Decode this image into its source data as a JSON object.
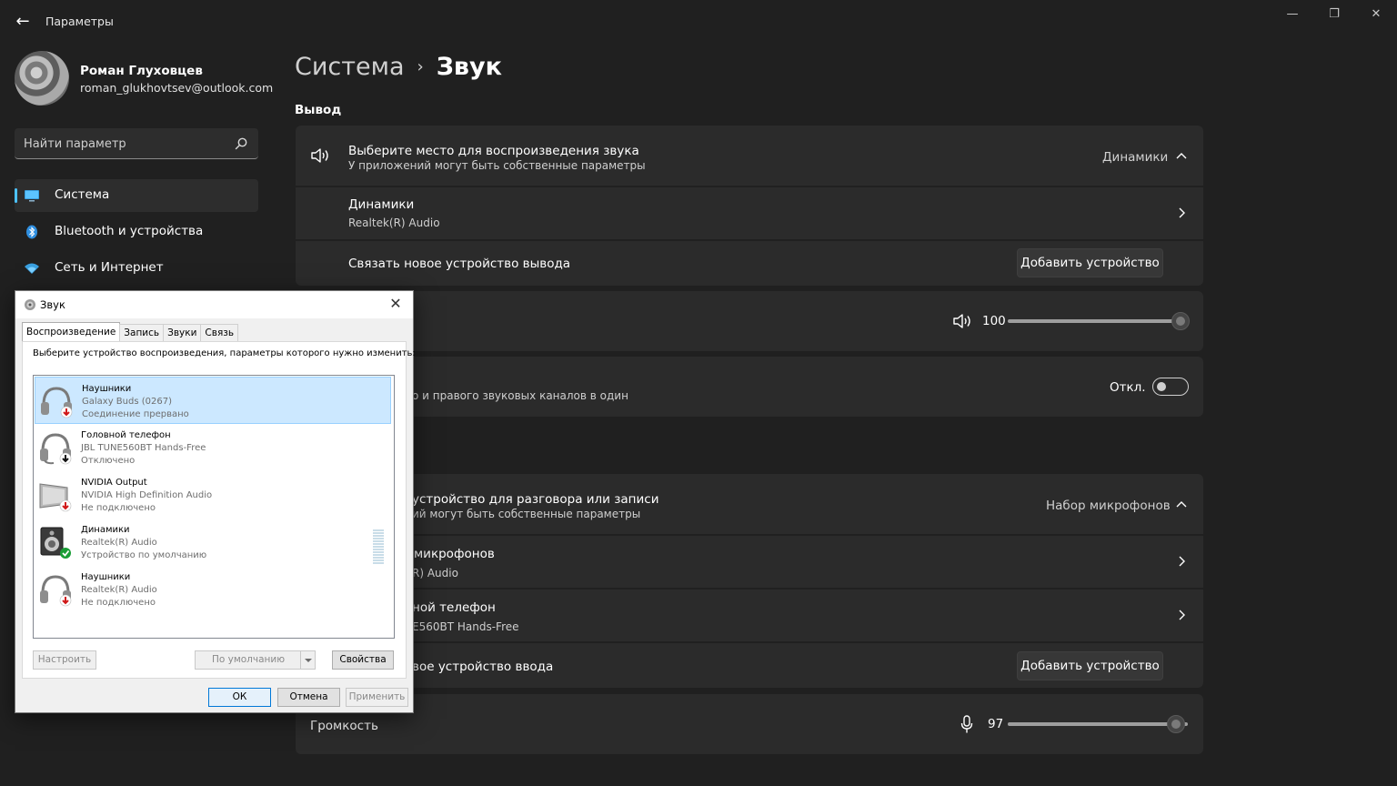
{
  "window": {
    "app_title": "Параметры",
    "back_glyph": "←",
    "minimize_glyph": "—",
    "maximize_glyph": "❐",
    "close_glyph": "✕"
  },
  "profile": {
    "name": "Роман Глуховцев",
    "email": "roman_glukhovtsev@outlook.com"
  },
  "search": {
    "placeholder": "Найти параметр",
    "icon": "search-icon"
  },
  "nav": {
    "items": [
      {
        "label": "Система",
        "icon": "monitor-icon",
        "active": true
      },
      {
        "label": "Bluetooth и устройства",
        "icon": "bluetooth-icon",
        "active": false
      },
      {
        "label": "Сеть и Интернет",
        "icon": "wifi-icon",
        "active": false
      }
    ]
  },
  "breadcrumb": {
    "parent": "Система",
    "separator": "›",
    "current": "Звук"
  },
  "output": {
    "section_title": "Вывод",
    "choose_title": "Выберите место для воспроизведения звука",
    "choose_sub": "У приложений могут быть собственные параметры",
    "choose_value": "Динамики",
    "device_name": "Динамики",
    "device_driver": "Realtek(R) Audio",
    "pair_label": "Связать новое устройство вывода",
    "add_button": "Добавить устройство",
    "volume_value": "100",
    "volume_level": 100,
    "mono_sub_partial": "о и правого звуковых каналов в один",
    "mono_state": "Откл."
  },
  "input": {
    "choose_title_partial": "устройство для разговора или записи",
    "choose_sub_partial": "ий могут быть собственные параметры",
    "choose_value": "Набор микрофонов",
    "device1_name_partial": "микрофонов",
    "device1_driver_partial": "R) Audio",
    "device2_name_partial": "ной телефон",
    "device2_driver_partial": "E560BT Hands-Free",
    "pair_label_partial": "вое устройство ввода",
    "add_button": "Добавить устройство",
    "volume_label": "Громкость",
    "volume_value": "97",
    "volume_level": 97
  },
  "dialog": {
    "title": "Звук",
    "close_glyph": "✕",
    "tabs": [
      "Воспроизведение",
      "Запись",
      "Звуки",
      "Связь"
    ],
    "instruction": "Выберите устройство воспроизведения, параметры которого нужно изменить:",
    "devices": [
      {
        "name": "Наушники",
        "driver": "Galaxy Buds (0267)",
        "status": "Соединение прервано",
        "icon": "headphones-icon",
        "badge": "red-down-arrow",
        "selected": true
      },
      {
        "name": "Головной телефон",
        "driver": "JBL TUNE560BT Hands-Free",
        "status": "Отключено",
        "icon": "headset-icon",
        "badge": "black-down-arrow",
        "selected": false
      },
      {
        "name": "NVIDIA Output",
        "driver": "NVIDIA High Definition Audio",
        "status": "Не подключено",
        "icon": "monitor-speaker-icon",
        "badge": "red-down-arrow",
        "selected": false
      },
      {
        "name": "Динамики",
        "driver": "Realtek(R) Audio",
        "status": "Устройство по умолчанию",
        "icon": "speaker-icon",
        "badge": "green-check",
        "selected": false
      },
      {
        "name": "Наушники",
        "driver": "Realtek(R) Audio",
        "status": "Не подключено",
        "icon": "headphones-icon",
        "badge": "red-down-arrow",
        "selected": false
      }
    ],
    "buttons": {
      "configure": "Настроить",
      "set_default": "По умолчанию",
      "properties": "Свойства",
      "ok": "ОК",
      "cancel": "Отмена",
      "apply": "Применить"
    }
  },
  "colors": {
    "background": "#202020",
    "card": "#2b2b2b",
    "accent": "#4cc2ff",
    "dialog_bg": "#f0f0f0",
    "selection": "#cce8ff"
  }
}
